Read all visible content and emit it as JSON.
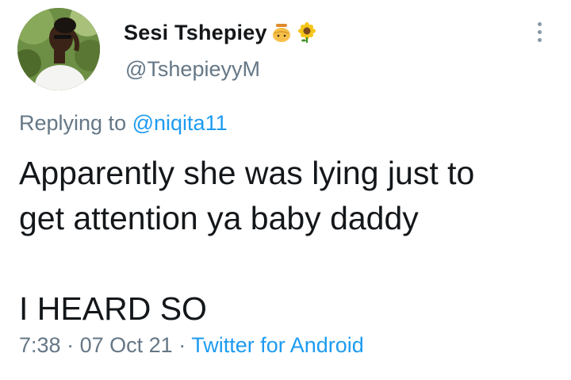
{
  "user": {
    "display_name": "Sesi Tshepiey",
    "handle": "@TshepieyyM",
    "emoji_1": "honey-pot-icon",
    "emoji_2": "sunflower-icon"
  },
  "reply": {
    "prefix": "Replying to",
    "mention": "@niqita11"
  },
  "tweet": {
    "line1": "Apparently she was lying just to",
    "line2": "get attention ya baby daddy",
    "line3": "I HEARD SO"
  },
  "meta": {
    "time": "7:38",
    "separator": "·",
    "date": "07 Oct 21",
    "source": "Twitter for Android"
  },
  "colors": {
    "link": "#1d9bf0",
    "secondary": "#657786",
    "primary": "#14171a"
  }
}
